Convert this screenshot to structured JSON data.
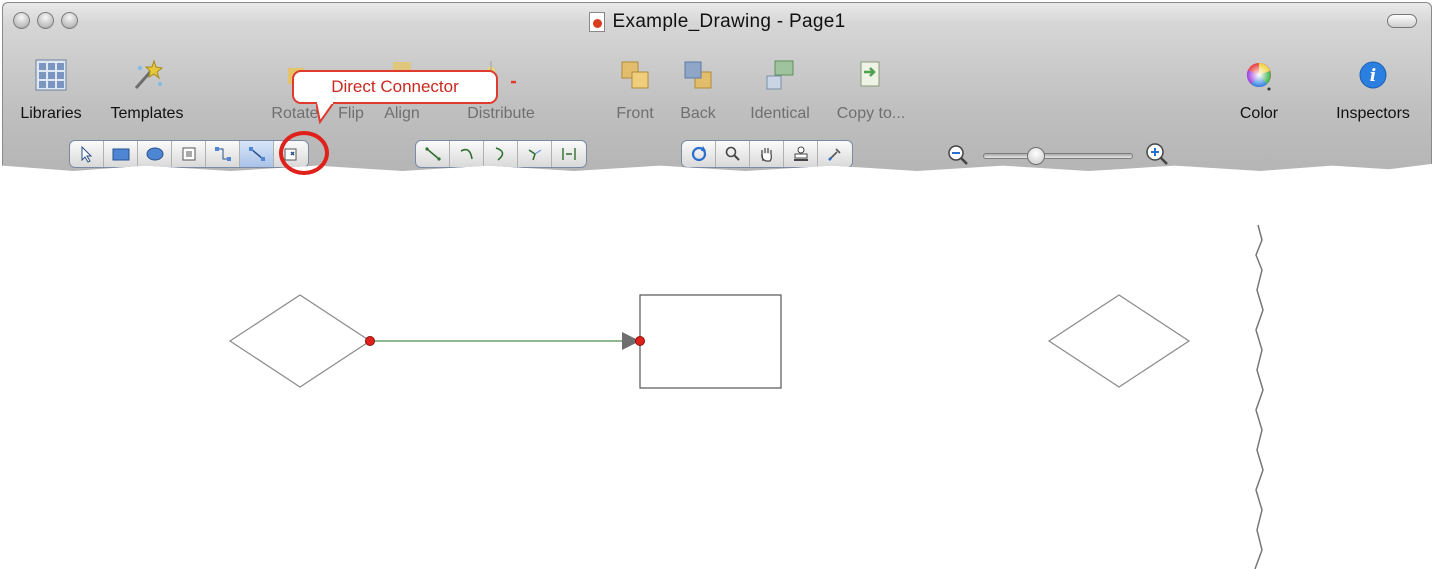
{
  "window": {
    "title": "Example_Drawing  -  Page1"
  },
  "toolbar": {
    "items": [
      {
        "label": "Libraries",
        "icon": "libraries-icon"
      },
      {
        "label": "Templates",
        "icon": "templates-icon"
      },
      {
        "label": "Rotate",
        "icon": "rotate-icon"
      },
      {
        "label": "Flip",
        "icon": "flip-icon"
      },
      {
        "label": "Align",
        "icon": "align-icon"
      },
      {
        "label": "Distribute",
        "icon": "distribute-icon"
      },
      {
        "label": "Front",
        "icon": "front-icon"
      },
      {
        "label": "Back",
        "icon": "back-icon"
      },
      {
        "label": "Identical",
        "icon": "identical-icon"
      },
      {
        "label": "Copy to...",
        "icon": "copy-to-icon"
      },
      {
        "label": "Color",
        "icon": "color-wheel-icon"
      },
      {
        "label": "Inspectors",
        "icon": "info-icon"
      }
    ]
  },
  "callout": {
    "text": "Direct Connector"
  },
  "tools": {
    "drawing": [
      "pointer-tool",
      "rectangle-tool",
      "oval-tool",
      "text-tool",
      "orthogonal-connector-tool",
      "direct-connector-tool",
      "edit-point-tool"
    ],
    "lines": [
      "straight-line-tool",
      "curved-line-tool",
      "arc-line-tool",
      "bezier-line-tool",
      "distribute-line-tool"
    ],
    "view": [
      "rotate-view-tool",
      "zoom-tool",
      "hand-tool",
      "stamp-tool",
      "eyedropper-tool"
    ],
    "active": "direct-connector-tool"
  },
  "colors": {
    "accent_red": "#e0201a",
    "connector_line": "#6aa36a",
    "selection_blue": "#a9c2e8"
  }
}
